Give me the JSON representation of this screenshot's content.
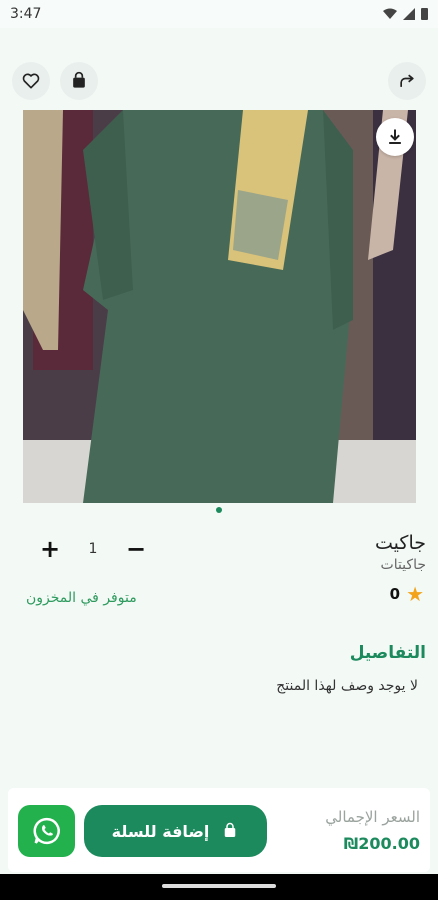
{
  "status_bar": {
    "time": "3:47"
  },
  "product": {
    "name": "جاكيت",
    "category": "جاكيتات",
    "rating": "0",
    "quantity": "1",
    "stock_status": "متوفر في المخزون"
  },
  "quantity_controls": {
    "plus": "+",
    "minus": "−"
  },
  "details": {
    "title": "التفاصيل",
    "description": "لا يوجد وصف لهذا المنتج"
  },
  "footer": {
    "add_to_cart_label": "إضافة للسلة",
    "total_label": "السعر الإجمالي",
    "total_value": "₪200.00"
  },
  "icons": {
    "favorite": "heart-icon",
    "cart": "shopping-bag-icon",
    "share": "share-icon",
    "download": "download-icon",
    "whatsapp": "whatsapp-icon",
    "star": "star-icon"
  },
  "colors": {
    "accent": "#1d8a5e",
    "whatsapp": "#22b14c",
    "star": "#f2a31b",
    "background": "#f3faf6"
  }
}
